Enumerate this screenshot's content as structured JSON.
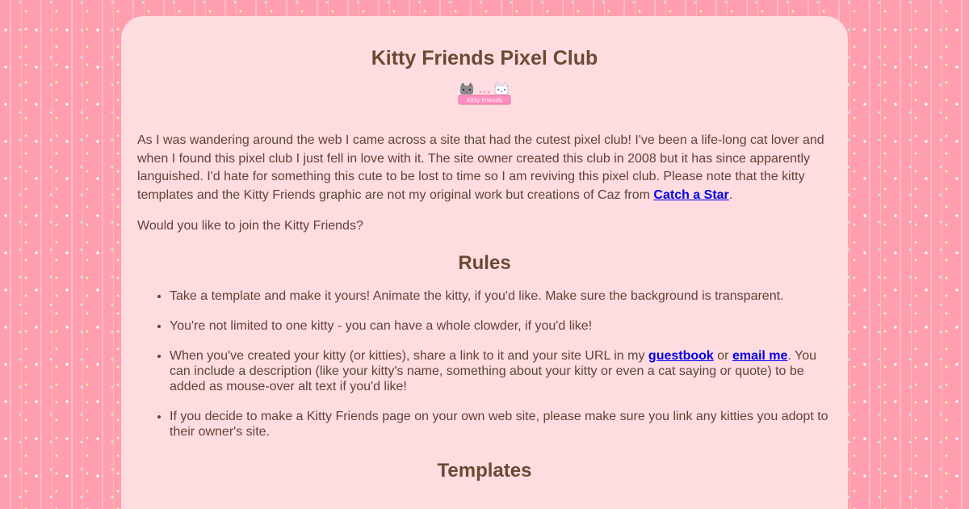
{
  "page": {
    "title": "Kitty Friends Pixel Club",
    "logo_text": "Kitty Friends",
    "intro_text": "As I was wandering around the web I came across a site that had the cutest pixel club! I've been a life-long cat lover and when I found this pixel club I just fell in love with it. The site owner created this club in 2008 but it has since apparently languished. I'd hate for something this cute to be lost to time so I am reviving this pixel club. Please note that the kitty templates and the Kitty Friends graphic are not my original work but creations of Caz from ",
    "intro_link": "Catch a Star",
    "intro_end": ".",
    "question": "Would you like to join the Kitty Friends?"
  },
  "rules": {
    "heading": "Rules",
    "item1": "Take a template and make it yours! Animate the kitty, if you'd like. Make sure the background is transparent.",
    "item2": "You're not limited to one kitty - you can have a whole clowder, if you'd like!",
    "item3_a": "When you've created your kitty (or kitties), share a link to it and your site URL in my ",
    "item3_link1": "guestbook",
    "item3_b": " or ",
    "item3_link2": "email me",
    "item3_c": ". You can include a description (like your kitty's name, something about your kitty or even a cat saying or quote) to be added as mouse-over alt text if you'd like!",
    "item4": "If you decide to make a Kitty Friends page on your own web site, please make sure you link any kitties you adopt to their owner's site."
  },
  "templates": {
    "heading": "Templates"
  },
  "colors": {
    "background": "#ff9eae",
    "card": "#ffdce0",
    "heading": "#6b4a35",
    "text": "#5e4535",
    "link": "#0000ee"
  }
}
